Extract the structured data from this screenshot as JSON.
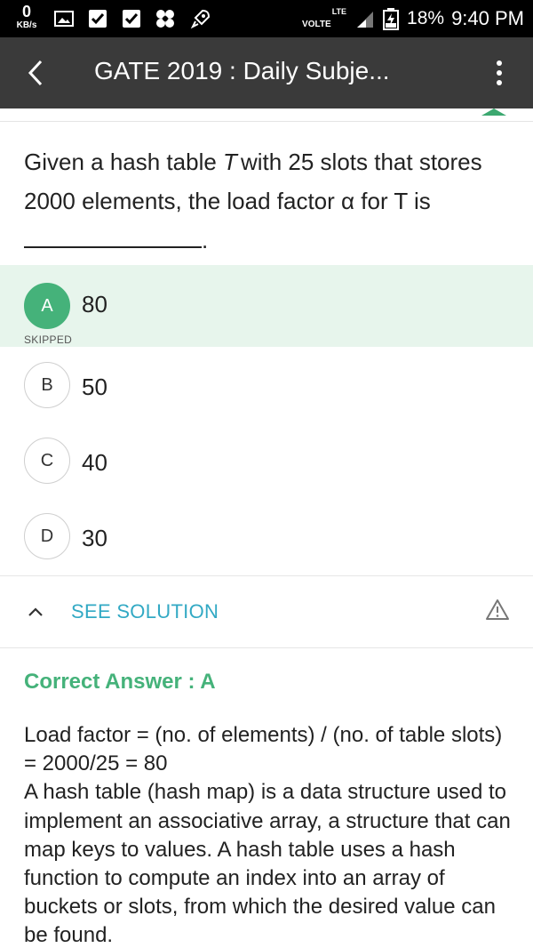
{
  "status_bar": {
    "speed_value": "0",
    "speed_unit": "KB/s",
    "network_lte": "LTE",
    "network_volte": "VOLTE",
    "battery": "18%",
    "time": "9:40 PM"
  },
  "app_bar": {
    "title": "GATE 2019 : Daily Subje..."
  },
  "question": {
    "text_part1": "Given a hash table",
    "variable": "T",
    "text_part2": "with 25 slots that stores 2000 elements, the load factor α for T is",
    "text_end": "."
  },
  "options": [
    {
      "letter": "A",
      "text": "80",
      "status": "SKIPPED"
    },
    {
      "letter": "B",
      "text": "50"
    },
    {
      "letter": "C",
      "text": "40"
    },
    {
      "letter": "D",
      "text": "30"
    }
  ],
  "solution": {
    "toggle_label": "SEE SOLUTION",
    "correct_answer": "Correct Answer : A",
    "line1": "Load factor = (no. of elements) / (no. of table slots) = 2000/25 = 80",
    "line2": "A hash table (hash map) is a data structure used to implement an associative array, a structure that can map keys to values. A hash table uses a hash function to compute an index into an array of buckets or slots, from which the desired value can be found."
  },
  "colors": {
    "accent_green": "#45b27a",
    "link_blue": "#32a9c4",
    "app_bar": "#3a3a3a"
  },
  "icons": [
    "back-arrow-icon",
    "more-vert-icon",
    "chevron-up-icon",
    "report-warning-icon",
    "image-icon",
    "checkbox-icon",
    "flower-icon",
    "rocket-icon",
    "signal-icon",
    "battery-icon"
  ]
}
